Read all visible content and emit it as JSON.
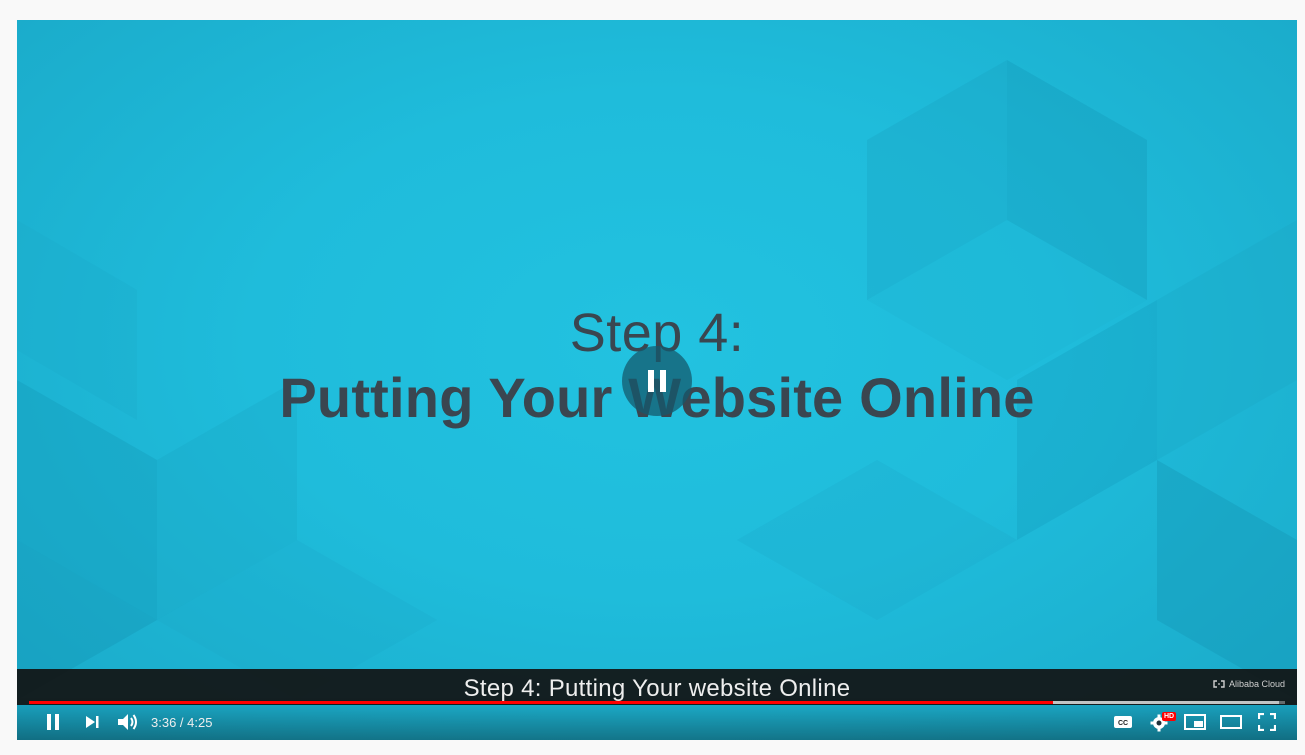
{
  "slide": {
    "line1": "Step 4:",
    "line2": "Putting Your Website Online"
  },
  "caption": {
    "text": "Step 4: Putting Your website Online",
    "watermark": "Alibaba Cloud"
  },
  "player": {
    "current_time": "3:36",
    "duration": "4:25",
    "time_display": "3:36 / 4:25",
    "progress_fraction": 0.815,
    "buffered_fraction": 0.995,
    "hd_badge": "HD",
    "cc_label": "CC"
  },
  "colors": {
    "video_bg": "#1fbcdb",
    "progress_played": "#ff0000",
    "slide_text": "#3a4650"
  },
  "icons": {
    "center": "pause-icon",
    "play_pause": "pause-icon",
    "next": "next-icon",
    "volume": "volume-icon",
    "subtitles": "subtitles-icon",
    "settings": "settings-gear-icon",
    "miniplayer": "miniplayer-icon",
    "theater": "theater-mode-icon",
    "fullscreen": "fullscreen-icon"
  }
}
